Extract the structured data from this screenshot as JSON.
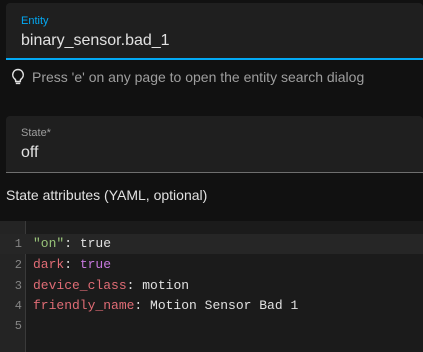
{
  "entity_field": {
    "label": "Entity",
    "value": "binary_sensor.bad_1"
  },
  "hint": {
    "text": "Press 'e' on any page to open the entity search dialog"
  },
  "state_field": {
    "label": "State*",
    "value": "off"
  },
  "attributes": {
    "title": "State attributes (YAML, optional)"
  },
  "editor": {
    "lines": [
      {
        "num": "1",
        "key": "\"on\"",
        "sep": ": ",
        "value": "true"
      },
      {
        "num": "2",
        "key": "dark",
        "sep": ": ",
        "value": "true"
      },
      {
        "num": "3",
        "key": "device_class",
        "sep": ": ",
        "value": "motion"
      },
      {
        "num": "4",
        "key": "friendly_name",
        "sep": ": ",
        "value": "Motion Sensor Bad 1"
      },
      {
        "num": "5",
        "key": "",
        "sep": "",
        "value": ""
      }
    ]
  },
  "colors": {
    "accent": "#03a9f4",
    "yaml_key": "#e06c75",
    "yaml_string": "#98c379",
    "yaml_bool": "#c678dd"
  }
}
